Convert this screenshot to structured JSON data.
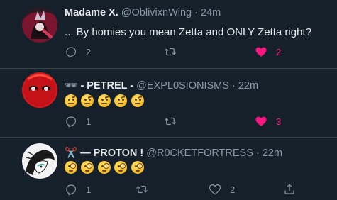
{
  "tweets": [
    {
      "name": "Madame X.",
      "handle": "@OblivixnWing",
      "time": "24m",
      "text": "... By homies you mean Zetta and ONLY Zetta right?",
      "replies": "2",
      "likes": "2",
      "liked": true
    },
    {
      "name_prefix": "🕶",
      "name": "- PETREL -",
      "handle": "@EXPL0SIONISMS",
      "time": "22m",
      "emoji_count": 5,
      "emoji_type": "face-with-raised-eyebrow",
      "replies": "1",
      "likes": "3",
      "liked": true
    },
    {
      "name_prefix": "✂️",
      "name": "— PROTON !",
      "handle": "@R0CKETFORTRESS",
      "time": "22m",
      "emoji_count": 5,
      "emoji_type": "face-with-monocle",
      "replies": "1",
      "likes": "2",
      "liked": false
    }
  ],
  "separator": "·",
  "colors": {
    "background": "#15202b",
    "divider": "#38444d",
    "secondary_text": "#8b98a5",
    "like_pink": "#f91880"
  }
}
